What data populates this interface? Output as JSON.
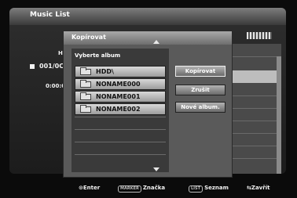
{
  "screen": {
    "title": "Music List"
  },
  "background": {
    "hd_label": "HI",
    "track": "001/0C",
    "time": "0:00:0"
  },
  "dialog": {
    "title": "Kopírovat",
    "list_label": "Vyberte album",
    "albums": [
      {
        "name": "HDD\\"
      },
      {
        "name": "NONAME000"
      },
      {
        "name": "NONAME001"
      },
      {
        "name": "NONAME002"
      }
    ],
    "buttons": {
      "copy": "Kopírovat",
      "cancel": "Zrušit",
      "new_album": "Nové album."
    }
  },
  "footer": {
    "enter": {
      "icon": "⊙",
      "label": "Enter"
    },
    "marker": {
      "key": "MARKER",
      "label": "Značka"
    },
    "list": {
      "key": "LIST",
      "label": "Seznam"
    },
    "close": {
      "icon": "⇆",
      "label": "Zavřít"
    }
  }
}
